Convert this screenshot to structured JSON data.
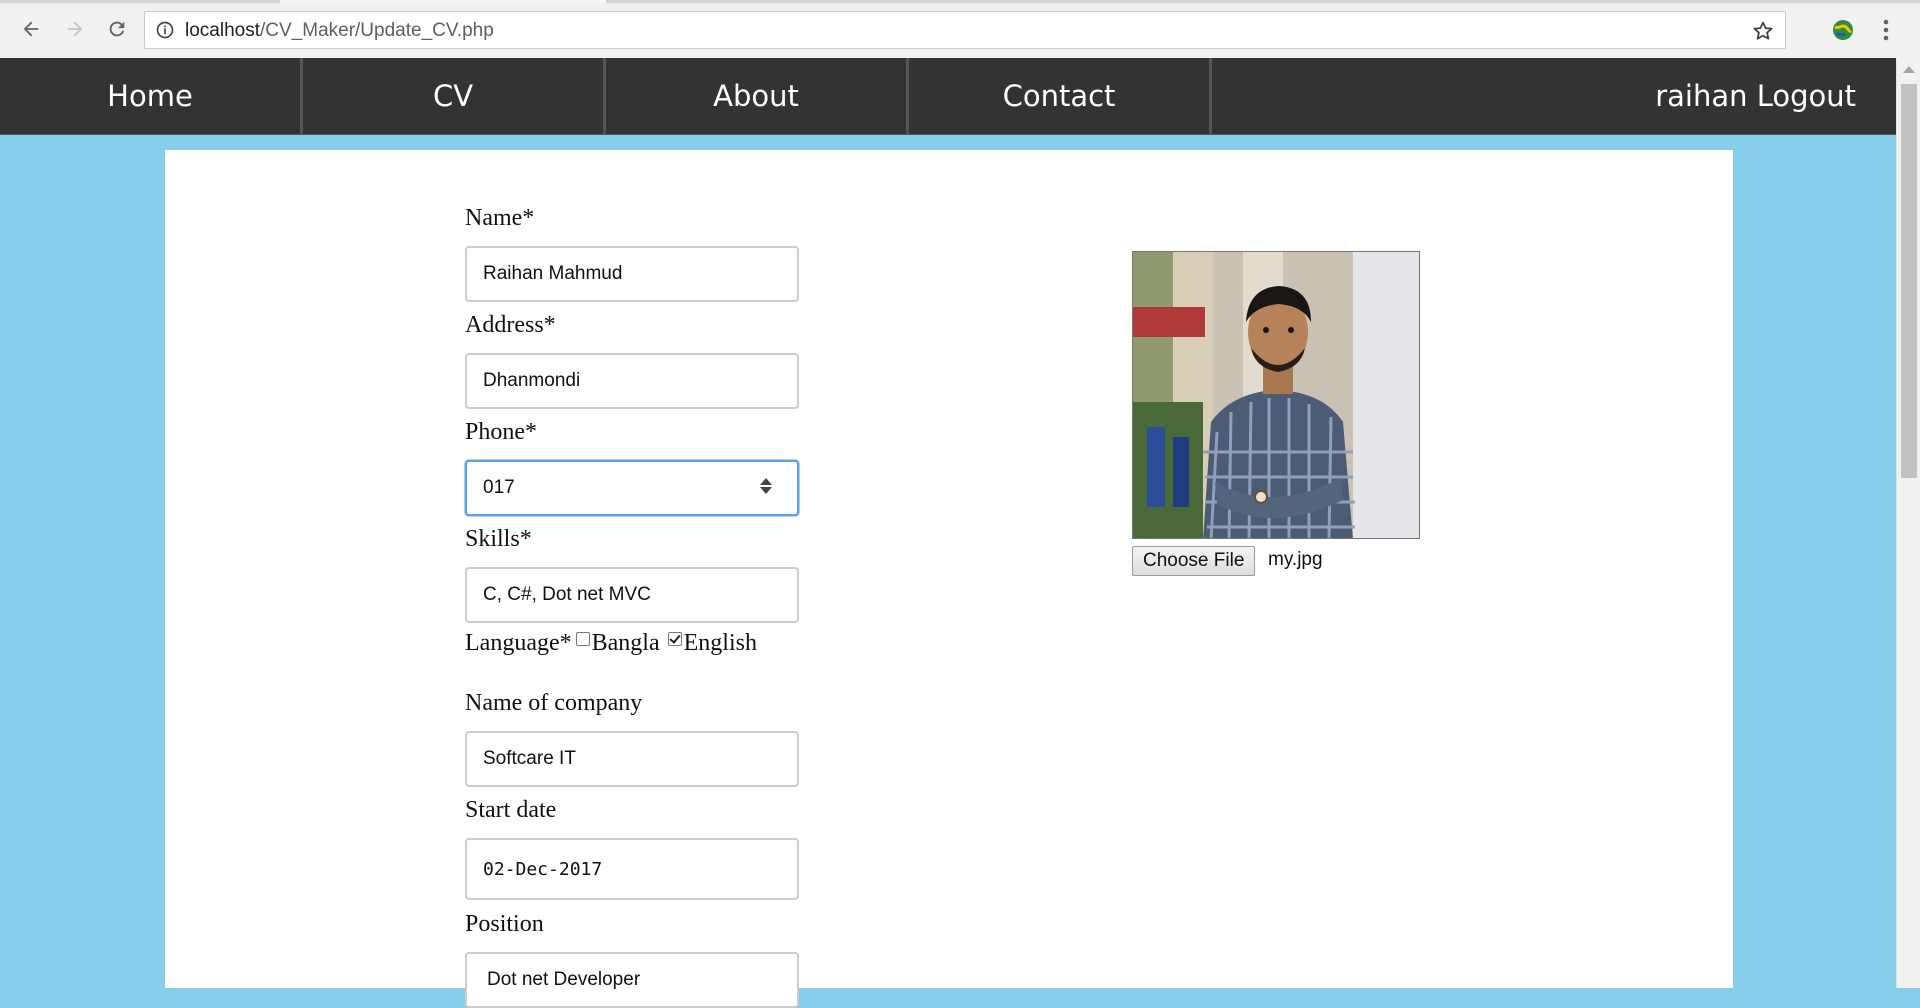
{
  "browser": {
    "url_host": "localhost",
    "url_path": "/CV_Maker/Update_CV.php"
  },
  "nav": {
    "items": [
      "Home",
      "CV",
      "About",
      "Contact"
    ],
    "user_logout": "raihan Logout"
  },
  "form": {
    "name_label": "Name*",
    "name_value": "Raihan Mahmud",
    "address_label": "Address*",
    "address_value": "Dhanmondi",
    "phone_label": "Phone*",
    "phone_value": "017",
    "skills_label": "Skills*",
    "skills_value": "C, C#, Dot net MVC",
    "language_label": "Language*",
    "language_options": [
      {
        "label": "Bangla",
        "checked": false
      },
      {
        "label": "English",
        "checked": true
      }
    ],
    "company_label": "Name of company",
    "company_value": "Softcare IT",
    "start_label": "Start date",
    "start_value": "02-Dec-2017",
    "position_label": "Position",
    "position_value": "Dot net Developer"
  },
  "photo": {
    "choose_label": "Choose File",
    "file_name": "my.jpg"
  },
  "colors": {
    "page_bg": "#87ceeb",
    "nav_bg": "#333333",
    "focus": "#5b9ee8"
  }
}
